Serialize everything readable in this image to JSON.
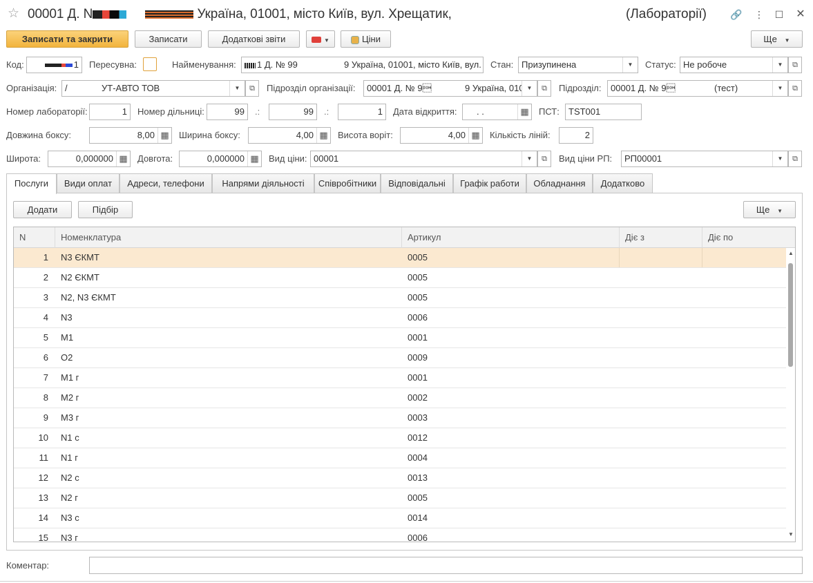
{
  "window": {
    "title_left": "00001 Д. N",
    "title_mid": "Україна, 01001, місто Київ, вул. Хрещатик,",
    "title_right": "(Лабораторії)"
  },
  "toolbar": {
    "save_close": "Записати та закрити",
    "save": "Записати",
    "reports": "Додаткові звіти",
    "prices": "Ціни",
    "more": "Ще"
  },
  "form": {
    "code_label": "Код:",
    "code_value": "1",
    "mobile_label": "Пересувна:",
    "name_label": "Найменування:",
    "name_value": "1 Д. № 99",
    "name_value_tail": "9 Україна, 01001, місто Київ, вул.",
    "state_label": "Стан:",
    "state_value": "Призупинена",
    "status_label": "Статус:",
    "status_value": "Не робоче",
    "org_label": "Організація:",
    "org_value": "УТ-АВТО ТОВ",
    "org_value_lead": "/",
    "org_unit_label": "Підрозділ організації:",
    "org_unit_value": "00001 Д. № 9\u0001",
    "org_unit_value_tail": "9 Україна, 010",
    "unit_label": "Підрозділ:",
    "unit_value": "00001 Д. № 9\u0001",
    "unit_value_tail": "(тест)",
    "lab_no_label": "Номер лабораторії:",
    "lab_no_value": "1",
    "site_no_label": "Номер дільниці:",
    "site_no_value1": "99",
    "site_no_value2": "99",
    "site_no_value3": "1",
    "site_sep1": ".:",
    "site_sep2": ".:",
    "open_date_label": "Дата відкриття:",
    "open_date_value": ".  .",
    "pst_label": "ПСТ:",
    "pst_value": "TST001",
    "box_len_label": "Довжина боксу:",
    "box_len_value": "8,00",
    "box_width_label": "Ширина боксу:",
    "box_width_value": "4,00",
    "gate_height_label": "Висота воріт:",
    "gate_height_value": "4,00",
    "lines_label": "Кількість ліній:",
    "lines_value": "2",
    "lat_label": "Широта:",
    "lat_value": "0,000000",
    "lon_label": "Довгота:",
    "lon_value": "0,000000",
    "price_type_label": "Вид ціни:",
    "price_type_value": "00001",
    "price_type_rp_label": "Вид ціни РП:",
    "price_type_rp_value": "РП00001",
    "comment_label": "Коментар:",
    "comment_value": ""
  },
  "tabs": [
    "Послуги",
    "Види оплат",
    "Адреси, телефони",
    "Напрями діяльності",
    "Співробітники",
    "Відповідальні",
    "Графік работи",
    "Обладнання",
    "Додатково"
  ],
  "services": {
    "add": "Додати",
    "pick": "Підбір",
    "more": "Ще",
    "columns": [
      "N",
      "Номенклатура",
      "Артикул",
      "Діє з",
      "Діє по"
    ],
    "rows": [
      {
        "n": "1",
        "name": "N3 ЄКМТ",
        "sku": "0005"
      },
      {
        "n": "2",
        "name": "N2 ЄКМТ",
        "sku": "0005"
      },
      {
        "n": "3",
        "name": "N2, N3 ЄКМТ",
        "sku": "0005"
      },
      {
        "n": "4",
        "name": "N3",
        "sku": "0006"
      },
      {
        "n": "5",
        "name": "M1",
        "sku": "0001"
      },
      {
        "n": "6",
        "name": "O2",
        "sku": "0009"
      },
      {
        "n": "7",
        "name": "M1 г",
        "sku": "0001"
      },
      {
        "n": "8",
        "name": "M2 г",
        "sku": "0002"
      },
      {
        "n": "9",
        "name": "M3 г",
        "sku": "0003"
      },
      {
        "n": "10",
        "name": "N1 с",
        "sku": "0012"
      },
      {
        "n": "11",
        "name": "N1 г",
        "sku": "0004"
      },
      {
        "n": "12",
        "name": "N2 с",
        "sku": "0013"
      },
      {
        "n": "13",
        "name": "N2 г",
        "sku": "0005"
      },
      {
        "n": "14",
        "name": "N3 с",
        "sku": "0014"
      },
      {
        "n": "15",
        "name": "N3 г",
        "sku": "0006"
      }
    ]
  },
  "colors": {
    "primary_button": "#f2b43d",
    "selected_row": "#fbe9d0",
    "checkbox_border": "#e0a13a"
  }
}
